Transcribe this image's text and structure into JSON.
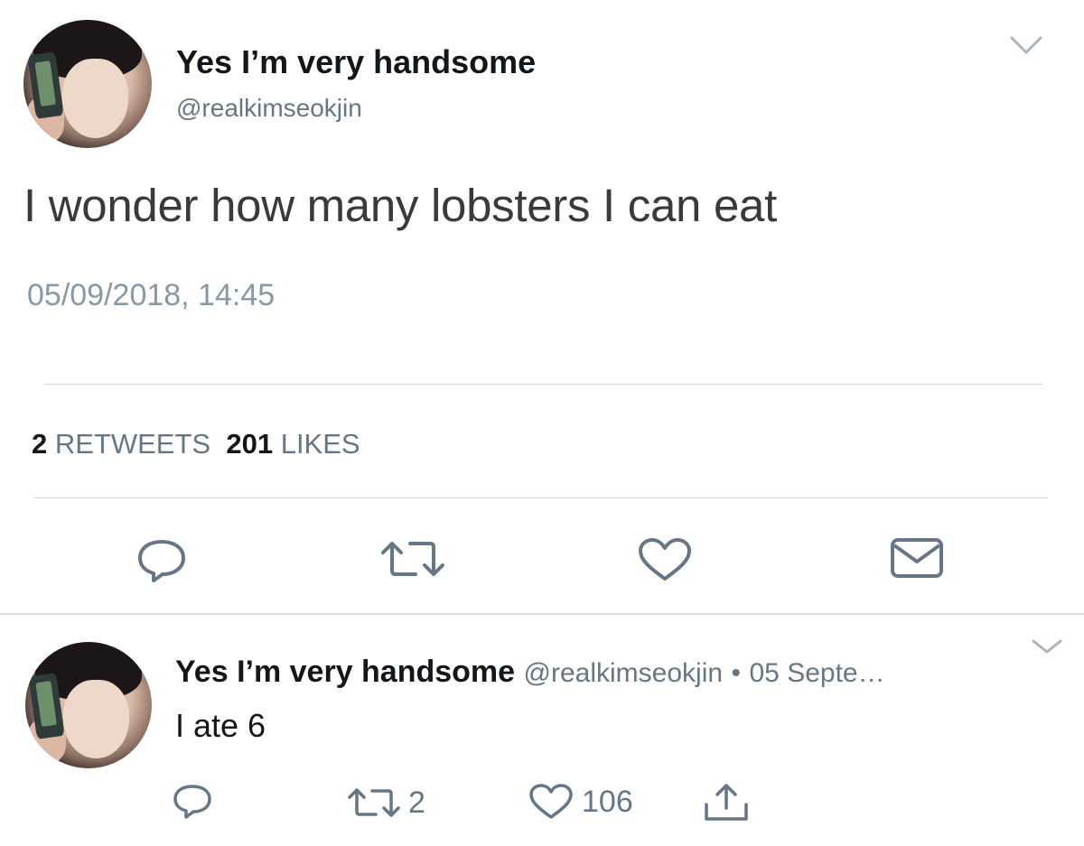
{
  "main_tweet": {
    "display_name": "Yes I’m very handsome",
    "handle": "@realkimseokjin",
    "text": "I wonder how many lobsters I can eat",
    "timestamp": "05/09/2018, 14:45",
    "retweets_count": "2",
    "retweets_label": "RETWEETS",
    "likes_count": "201",
    "likes_label": "LIKES",
    "actions": [
      "reply-icon",
      "retweet-icon",
      "like-icon",
      "message-icon"
    ]
  },
  "reply_tweet": {
    "display_name": "Yes I’m very handsome",
    "handle": "@realkimseokjin",
    "separator": "•",
    "date": "05 Septe…",
    "text": "I ate 6",
    "retweet_count": "2",
    "like_count": "106",
    "actions": [
      "reply-icon",
      "retweet-icon",
      "like-icon",
      "share-icon"
    ]
  },
  "colors": {
    "text_primary": "#14171a",
    "text_secondary": "#657786",
    "timestamp": "#8899a6",
    "divider": "#cfd6dc",
    "icon": "#657786"
  }
}
